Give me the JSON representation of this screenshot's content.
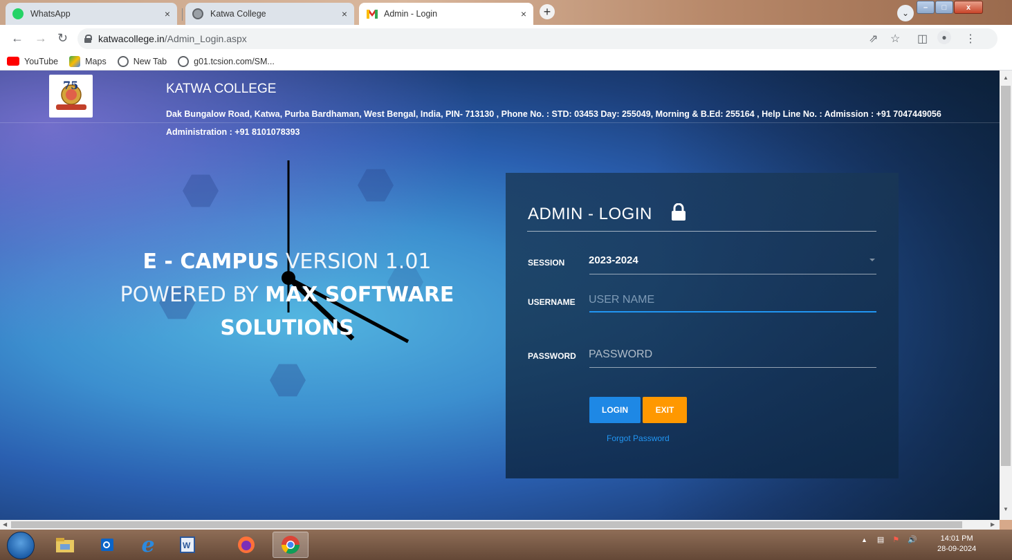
{
  "browser": {
    "tabs": [
      {
        "label": "WhatsApp",
        "icon": "whatsapp-icon"
      },
      {
        "label": "Katwa College",
        "icon": "globe-icon"
      },
      {
        "label": "Admin - Login",
        "icon": "gmail-icon"
      }
    ],
    "close_glyph": "×",
    "new_tab_glyph": "+",
    "url_host": "katwacollege.in",
    "url_path": "/Admin_Login.aspx",
    "bookmarks": [
      {
        "label": "YouTube",
        "icon": "youtube-icon"
      },
      {
        "label": "Maps",
        "icon": "maps-icon"
      },
      {
        "label": "New Tab",
        "icon": "globe-icon"
      },
      {
        "label": "g01.tcsion.com/SM...",
        "icon": "globe-icon"
      }
    ]
  },
  "page": {
    "college_name": "KATWA COLLEGE",
    "college_address": "Dak Bungalow Road, Katwa, Purba Bardhaman, West Bengal, India, PIN- 713130  , Phone No. : STD: 03453 Day: 255049, Morning & B.Ed: 255164  , Help Line No. : Admission : +91 7047449056 Administration : +91 8101078393",
    "brand_line1_bold": "E - CAMPUS",
    "brand_line1_light": " VERSION 1.01",
    "brand_line2_light": "POWERED BY  ",
    "brand_line2_bold": "MAX SOFTWARE SOLUTIONS"
  },
  "login": {
    "title": "ADMIN - LOGIN",
    "session_label": "SESSION",
    "session_value": "2023-2024",
    "username_label": "USERNAME",
    "username_placeholder": "USER NAME",
    "password_label": "PASSWORD",
    "password_placeholder": "PASSWORD",
    "login_button": "LOGIN",
    "exit_button": "EXIT",
    "forgot_password": "Forgot Password"
  },
  "taskbar": {
    "time": "14:01 PM",
    "date": "28-09-2024"
  },
  "colors": {
    "login_button": "#1e88e5",
    "exit_button": "#ff9800",
    "link": "#2196f3"
  }
}
